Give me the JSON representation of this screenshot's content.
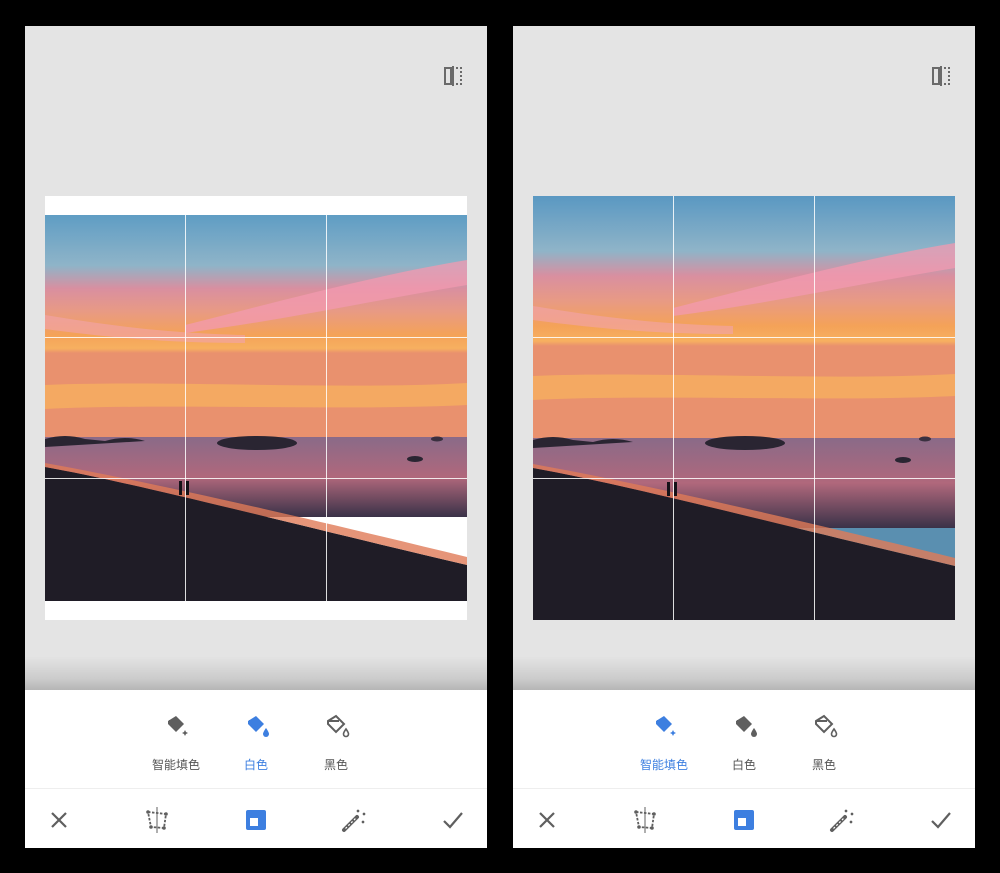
{
  "screens": [
    {
      "id": "left",
      "selected_fill": "white",
      "fill_options": [
        {
          "key": "smart",
          "label": "智能填色",
          "icon": "paint-bucket-sparkle-icon"
        },
        {
          "key": "white",
          "label": "白色",
          "icon": "paint-bucket-white-icon"
        },
        {
          "key": "black",
          "label": "黑色",
          "icon": "paint-bucket-black-icon"
        }
      ]
    },
    {
      "id": "right",
      "selected_fill": "smart",
      "fill_options": [
        {
          "key": "smart",
          "label": "智能填色",
          "icon": "paint-bucket-sparkle-icon"
        },
        {
          "key": "white",
          "label": "白色",
          "icon": "paint-bucket-white-icon"
        },
        {
          "key": "black",
          "label": "黑色",
          "icon": "paint-bucket-black-icon"
        }
      ]
    }
  ],
  "toolbar": {
    "cancel_icon": "close-icon",
    "perspective_icon": "perspective-icon",
    "expand_icon": "expand-icon",
    "magic_icon": "magic-wand-icon",
    "apply_icon": "checkmark-icon"
  },
  "header": {
    "compare_icon": "compare-icon"
  },
  "colors": {
    "accent": "#3d7fe0",
    "icon_gray": "#5f5f5f",
    "canvas_bg": "#e4e4e4",
    "panel_bg": "#ffffff",
    "white_fill": "#ffffff"
  }
}
